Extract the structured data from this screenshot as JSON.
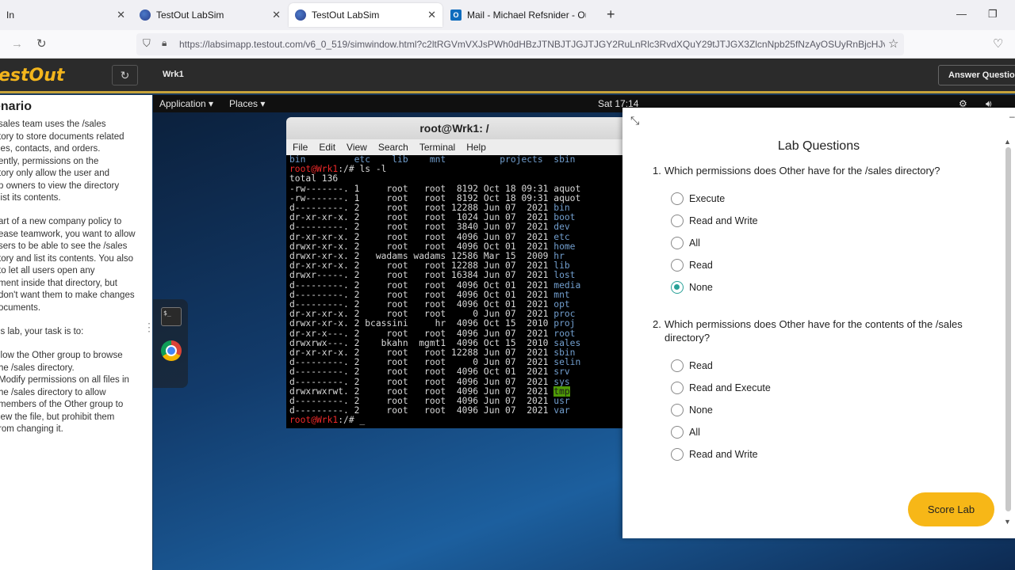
{
  "browser": {
    "tabs": [
      {
        "label": "In",
        "active": false
      },
      {
        "label": "TestOut LabSim",
        "active": false
      },
      {
        "label": "TestOut LabSim",
        "active": true
      },
      {
        "label": "Mail - Michael Refsnider - Outlo",
        "active": false
      }
    ],
    "url": "https://labsimapp.testout.com/v6_0_519/simwindow.html?c2ltRGVmVXJsPWh0dHBzJTNBJTJGJTJGY2RuLnRlc3RvdXQuY29tJTJGX3ZlcnNpb25fNzAyOSUyRnBjcHJvMjAyM"
  },
  "app": {
    "logo": "estOut",
    "workstation": "Wrk1",
    "answer_button": "Answer Question"
  },
  "scenario": {
    "title": "enario",
    "para1": "sales team uses the /sales\ntory to store documents related\nles, contacts, and orders.\nently, permissions on the\ntory only allow the user and\np owners to view the directory\nlist its contents.",
    "para2": "art of a new company policy to\nease teamwork, you want to allow\nsers to be able to see the /sales\ntory and list its contents. You also\n to let all users open any\nment inside that directory, but\ndon't want them to make changes\nocuments.",
    "para3": "is lab, your task is to:",
    "task1": "llow the Other group to browse\nhe /sales directory.",
    "task2": "Modify permissions on all files in\nhe /sales directory to allow\nmembers of the Other group to\niew the file, but prohibit them\nrom changing it."
  },
  "desktop": {
    "application_menu": "Application ▾",
    "places_menu": "Places ▾",
    "clock": "Sat 17:14"
  },
  "terminal": {
    "title": "root@Wrk1: /",
    "menus": [
      "File",
      "Edit",
      "View",
      "Search",
      "Terminal",
      "Help"
    ],
    "top_line": "bin         etc    lib    mnt          projects  sbin",
    "prompt": "root@Wrk1",
    "prompt_path": ":/# ",
    "command": "ls -l",
    "total": "total 136",
    "rows": [
      {
        "line": "-rw-------. 1     root   root  8192 Oct 18 09:31 ",
        "name": "aquot",
        "cls": ""
      },
      {
        "line": "-rw-------. 1     root   root  8192 Oct 18 09:31 ",
        "name": "aquot",
        "cls": ""
      },
      {
        "line": "d---------. 2     root   root 12288 Jun 07  2021 ",
        "name": "bin",
        "cls": "blu"
      },
      {
        "line": "dr-xr-xr-x. 2     root   root  1024 Jun 07  2021 ",
        "name": "boot",
        "cls": "blu"
      },
      {
        "line": "d---------. 2     root   root  3840 Jun 07  2021 ",
        "name": "dev",
        "cls": "blu"
      },
      {
        "line": "dr-xr-xr-x. 2     root   root  4096 Jun 07  2021 ",
        "name": "etc",
        "cls": "blu"
      },
      {
        "line": "drwxr-xr-x. 2     root   root  4096 Oct 01  2021 ",
        "name": "home",
        "cls": "blu"
      },
      {
        "line": "drwxr-xr-x. 2   wadams wadams 12586 Mar 15  2009 ",
        "name": "hr",
        "cls": "blu"
      },
      {
        "line": "dr-xr-xr-x. 2     root   root 12288 Jun 07  2021 ",
        "name": "lib",
        "cls": "blu"
      },
      {
        "line": "drwxr-----. 2     root   root 16384 Jun 07  2021 ",
        "name": "lost",
        "cls": "blu"
      },
      {
        "line": "d---------. 2     root   root  4096 Oct 01  2021 ",
        "name": "media",
        "cls": "blu"
      },
      {
        "line": "d---------. 2     root   root  4096 Oct 01  2021 ",
        "name": "mnt",
        "cls": "blu"
      },
      {
        "line": "d---------. 2     root   root  4096 Oct 01  2021 ",
        "name": "opt",
        "cls": "blu"
      },
      {
        "line": "dr-xr-xr-x. 2     root   root     0 Jun 07  2021 ",
        "name": "proc",
        "cls": "blu"
      },
      {
        "line": "drwxr-xr-x. 2 bcassini     hr  4096 Oct 15  2010 ",
        "name": "proj",
        "cls": "blu"
      },
      {
        "line": "dr-xr-x---. 2     root   root  4096 Jun 07  2021 ",
        "name": "root",
        "cls": "blu"
      },
      {
        "line": "drwxrwx---. 2    bkahn  mgmt1  4096 Oct 15  2010 ",
        "name": "sales",
        "cls": "blu"
      },
      {
        "line": "dr-xr-xr-x. 2     root   root 12288 Jun 07  2021 ",
        "name": "sbin",
        "cls": "blu"
      },
      {
        "line": "d---------. 2     root   root     0 Jun 07  2021 ",
        "name": "selin",
        "cls": "blu"
      },
      {
        "line": "d---------. 2     root   root  4096 Oct 01  2021 ",
        "name": "srv",
        "cls": "blu"
      },
      {
        "line": "d---------. 2     root   root  4096 Jun 07  2021 ",
        "name": "sys",
        "cls": "blu"
      },
      {
        "line": "drwxrwxrwt. 2     root   root  4096 Jun 07  2021 ",
        "name": "tmp",
        "cls": "hlt"
      },
      {
        "line": "d---------. 2     root   root  4096 Jun 07  2021 ",
        "name": "usr",
        "cls": "blu"
      },
      {
        "line": "d---------. 2     root   root  4096 Jun 07  2021 ",
        "name": "var",
        "cls": "blu"
      }
    ],
    "final_prompt_path": ":/# _"
  },
  "lab": {
    "title": "Lab Questions",
    "questions": [
      {
        "number": "1.",
        "text": "Which permissions does Other have for the /sales directory?",
        "options": [
          "Execute",
          "Read and Write",
          "All",
          "Read",
          "None"
        ],
        "selected": 4
      },
      {
        "number": "2.",
        "text": "Which permissions does Other have for the contents of the /sales directory?",
        "options": [
          "Read",
          "Read and Execute",
          "None",
          "All",
          "Read and Write"
        ],
        "selected": -1
      }
    ],
    "score_button": "Score Lab"
  },
  "colors": {
    "accent_yellow": "#f7b717",
    "radio_selected": "#2aa198",
    "logo": "#f3b51c"
  }
}
